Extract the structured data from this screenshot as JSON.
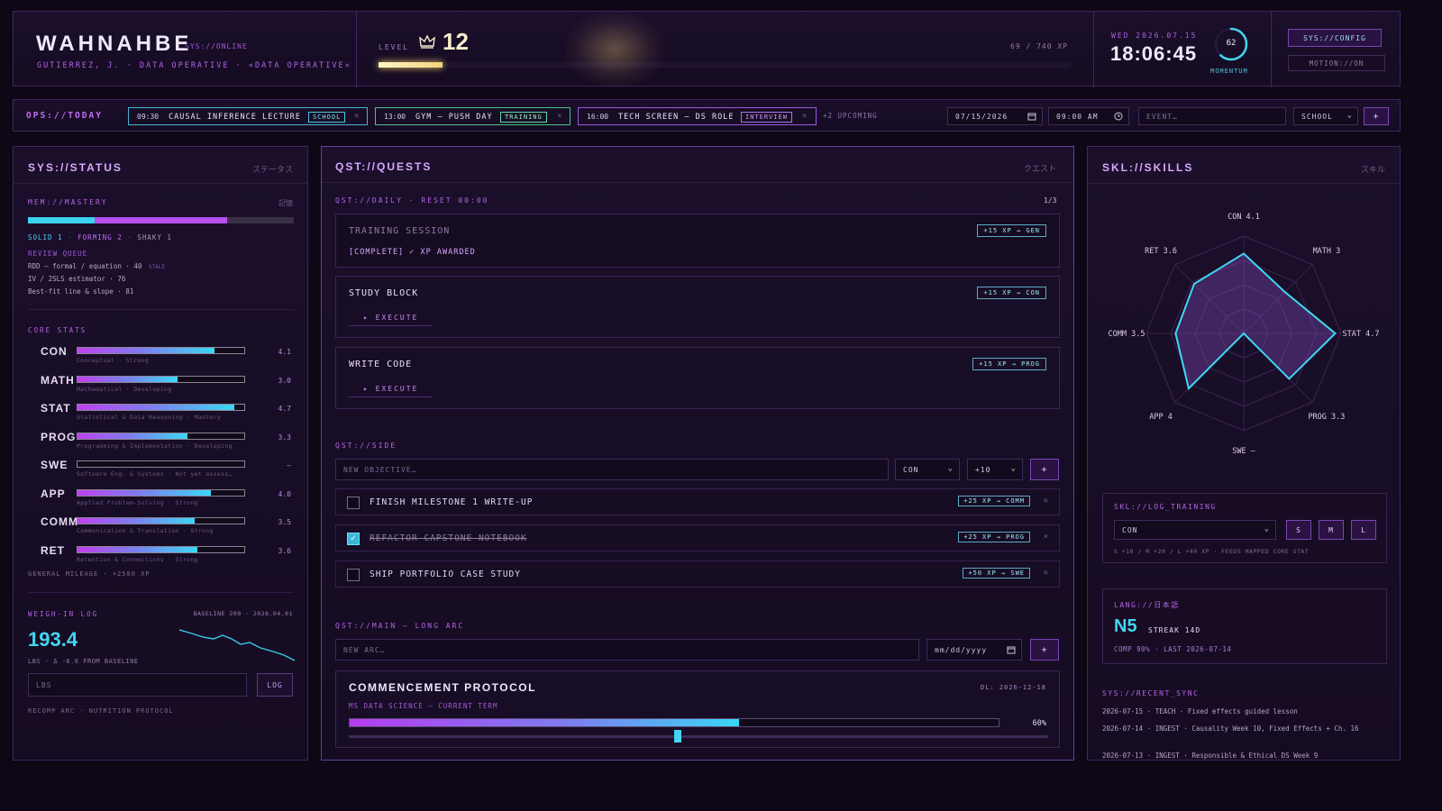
{
  "header": {
    "title": "WAHNAHBE",
    "status": "SYS://ONLINE",
    "subtitle": "GUTIERREZ, J. · DATA OPERATIVE · «DATA OPERATIVE»",
    "level_label": "LEVEL",
    "level": "12",
    "xp_text": "69 / 740 XP",
    "xp_progress": 0.093,
    "date": "WED 2026.07.15",
    "time": "18:06:45",
    "momentum_value": "62",
    "momentum_fraction": 0.62,
    "momentum_label": "MOMENTUM",
    "config_button": "SYS://CONFIG",
    "motion_button": "MOTION://ON"
  },
  "ops": {
    "label": "OPS://TODAY",
    "events": [
      {
        "time": "09:30",
        "title": "CAUSAL INFERENCE LECTURE",
        "tag": "SCHOOL"
      },
      {
        "time": "13:00",
        "title": "GYM — PUSH DAY",
        "tag": "TRAINING"
      },
      {
        "time": "16:00",
        "title": "TECH SCREEN — DS ROLE",
        "tag": "INTERVIEW"
      }
    ],
    "close": "×",
    "upcoming": "+2 UPCOMING",
    "date_value": "07/15/2026",
    "time_value": "09:00 AM",
    "event_placeholder": "EVENT…",
    "category": "SCHOOL",
    "add": "+"
  },
  "status": {
    "title": "SYS://STATUS",
    "title_jp": "ステータス",
    "mastery_label": "MEM://MASTERY",
    "mastery_jp": "記憶",
    "mastery_solid": 0.25,
    "mastery_forming": 0.75,
    "mastery_legend": [
      "SOLID 1",
      "FORMING 2",
      "SHAKY 1"
    ],
    "review_label": "REVIEW QUEUE",
    "review_items": [
      "RDD — formal / equation · 40",
      "IV / 2SLS estimator · 76",
      "Best-fit line & slope · 81"
    ],
    "stale_tag": "STALE",
    "core_label": "CORE STATS",
    "stats": [
      {
        "name": "CON",
        "desc": "Conceptual · Strong",
        "value": "4.1",
        "level": 0.82
      },
      {
        "name": "MATH",
        "desc": "Mathematical · Developing",
        "value": "3.0",
        "level": 0.6
      },
      {
        "name": "STAT",
        "desc": "Statistical & Data Reasoning · Mastery",
        "value": "4.7",
        "level": 0.94
      },
      {
        "name": "PROG",
        "desc": "Programming & Implementation · Developing",
        "value": "3.3",
        "level": 0.66
      },
      {
        "name": "SWE",
        "desc": "Software Eng. & Systems · Not yet assess…",
        "value": "—",
        "level": 0
      },
      {
        "name": "APP",
        "desc": "Applied Problem-Solving · Strong",
        "value": "4.0",
        "level": 0.8
      },
      {
        "name": "COMM",
        "desc": "Communication & Translation · Strong",
        "value": "3.5",
        "level": 0.7
      },
      {
        "name": "RET",
        "desc": "Retention & Connections · Strong",
        "value": "3.6",
        "level": 0.72
      }
    ],
    "mileage": "GENERAL MILEAGE · +2580 XP",
    "weigh_label": "WEIGH-IN LOG",
    "baseline": "BASELINE 200 · 2026.04.01",
    "weight": "193.4",
    "weight_sub": "LBS · Δ -6.6 FROM BASELINE",
    "lbs_placeholder": "LBS",
    "log_button": "LOG",
    "protocol": "RECOMP ARC · NUTRITION PROTOCOL"
  },
  "quests": {
    "title": "QST://QUESTS",
    "title_jp": "クエスト",
    "daily_label": "QST://DAILY · RESET 00:00",
    "daily_count": "1/3",
    "daily": [
      {
        "title": "TRAINING SESSION",
        "xp": "+15 XP → GEN",
        "status": "[COMPLETE] ✓ XP AWARDED"
      },
      {
        "title": "STUDY BLOCK",
        "xp": "+15 XP → CON",
        "action": "▸ EXECUTE"
      },
      {
        "title": "WRITE CODE",
        "xp": "+15 XP → PROG",
        "action": "▸ EXECUTE"
      }
    ],
    "side_label": "QST://SIDE",
    "side_placeholder": "NEW OBJECTIVE…",
    "side_stat": "CON",
    "side_xp": "+10",
    "side_add": "+",
    "side": [
      {
        "title": "FINISH MILESTONE 1 WRITE-UP",
        "xp": "+25 XP → COMM",
        "done": false
      },
      {
        "title": "REFACTOR CAPSTONE NOTEBOOK",
        "xp": "+25 XP → PROG",
        "done": true
      },
      {
        "title": "SHIP PORTFOLIO CASE STUDY",
        "xp": "+50 XP → SWE",
        "done": false
      }
    ],
    "remove": "×",
    "check": "✓",
    "main_label": "QST://MAIN — LONG ARC",
    "arc_placeholder": "NEW ARC…",
    "arc_date_placeholder": "mm/dd/yyyy",
    "arc_add": "+",
    "arc": {
      "title": "COMMENCEMENT PROTOCOL",
      "deadline": "DL: 2026-12-18",
      "subtitle": "MS DATA SCIENCE — CURRENT TERM",
      "percent": "60%",
      "progress": 0.6
    }
  },
  "skills": {
    "title": "SKL://SKILLS",
    "title_jp": "スキル",
    "radar": [
      {
        "label": "CON 4.1",
        "value": 4.1
      },
      {
        "label": "MATH 3",
        "value": 3.0
      },
      {
        "label": "STAT 4.7",
        "value": 4.7
      },
      {
        "label": "PROG 3.3",
        "value": 3.3
      },
      {
        "label": "SWE —",
        "value": 0
      },
      {
        "label": "APP 4",
        "value": 4.0
      },
      {
        "label": "COMM 3.5",
        "value": 3.5
      },
      {
        "label": "RET 3.6",
        "value": 3.6
      }
    ],
    "radar_max": 5,
    "log_label": "SKL://LOG_TRAINING",
    "log_stat": "CON",
    "sizes": [
      "S",
      "M",
      "L"
    ],
    "log_note": "S +10 / M +20 / L +40 XP · FEEDS MAPPED CORE STAT",
    "lang_label": "LANG://日本語",
    "lang_level": "N5",
    "streak": "STREAK 14D",
    "lang_sub": "COMP 90% · LAST 2026-07-14",
    "sync_label": "SYS://RECENT_SYNC",
    "sync": [
      "2026-07-15 · TEACH · Fixed effects guided lesson",
      "2026-07-14 · INGEST · Causality Week 10, Fixed Effects + Ch. 16",
      "2026-07-13 · INGEST · Responsible & Ethical DS Week 9"
    ]
  },
  "colors": {
    "accent": "#c46cf5",
    "cyan": "#37d6f0",
    "bg": "#0d0716"
  }
}
